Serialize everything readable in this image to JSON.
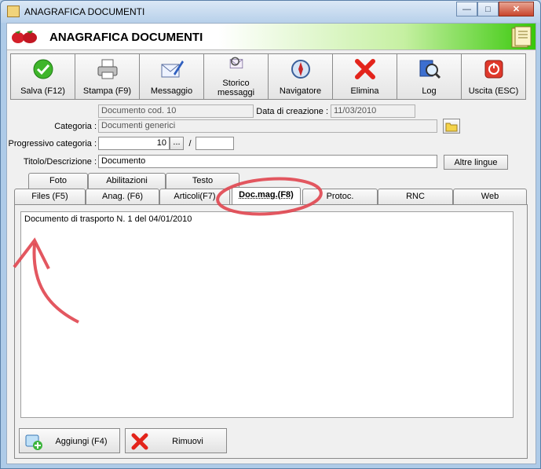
{
  "window": {
    "title": "ANAGRAFICA DOCUMENTI",
    "minimize_glyph": "—",
    "maximize_glyph": "□",
    "close_glyph": "✕"
  },
  "banner": {
    "title": "ANAGRAFICA DOCUMENTI"
  },
  "toolbar": {
    "salva": "Salva (F12)",
    "stampa": "Stampa (F9)",
    "messaggio": "Messaggio",
    "storico_line1": "Storico",
    "storico_line2": "messaggi",
    "navigatore": "Navigatore",
    "elimina": "Elimina",
    "log": "Log",
    "uscita": "Uscita (ESC)"
  },
  "form": {
    "doc_code": "Documento cod. 10",
    "creation_label": "Data di creazione :",
    "creation_value": "11/03/2010",
    "categoria_label": "Categoria :",
    "categoria_value": "Documenti generici",
    "progressivo_label": "Progressivo categoria :",
    "progressivo_value": "10",
    "progressivo_btn": "...",
    "slash": "/",
    "progressivo_suffix": "",
    "titolo_label": "Titolo/Descrizione :",
    "titolo_value": "Documento",
    "altre_lingue": "Altre lingue"
  },
  "tabs_row1": [
    "Foto",
    "Abilitazioni",
    "Testo"
  ],
  "tabs_row2": [
    "Files (F5)",
    "Anag. (F6)",
    "Articoli(F7)",
    "Doc.mag.(F8)",
    "Protoc.",
    "RNC",
    "Web"
  ],
  "active_tab": "Doc.mag.(F8)",
  "panel": {
    "memo_text": "Documento di trasporto N. 1 del 04/01/2010",
    "aggiungi": "Aggiungi (F4)",
    "rimuovi": "Rimuovi"
  },
  "colors": {
    "annotation": "#e0454f",
    "banner_green": "#38c80a"
  }
}
